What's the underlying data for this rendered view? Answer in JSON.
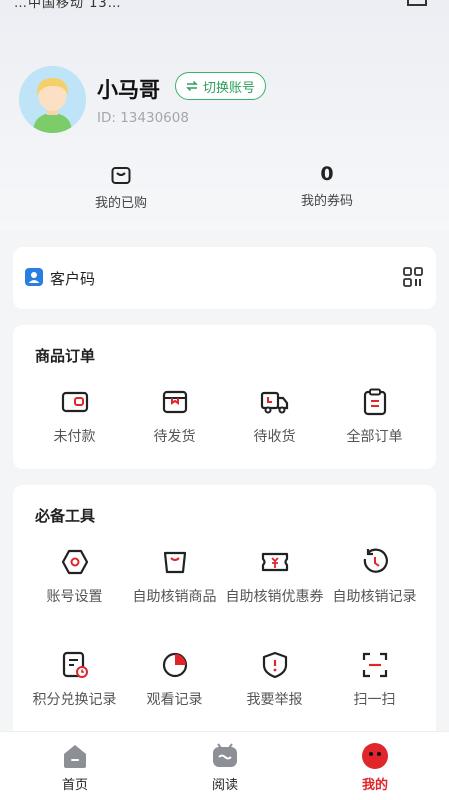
{
  "status_bar": {
    "text": "…中国移动 13…"
  },
  "profile": {
    "username": "小马哥",
    "switch_label": "切换账号",
    "user_id": "ID: 13430608"
  },
  "stats": [
    {
      "label": "我的已购",
      "value": ""
    },
    {
      "label": "我的券码",
      "value": "0"
    }
  ],
  "customer_code": {
    "label": "客户码"
  },
  "orders": {
    "title": "商品订单",
    "items": [
      {
        "label": "未付款",
        "icon": "wallet-icon"
      },
      {
        "label": "待发货",
        "icon": "box-icon"
      },
      {
        "label": "待收货",
        "icon": "truck-icon"
      },
      {
        "label": "全部订单",
        "icon": "clipboard-icon"
      }
    ]
  },
  "tools": {
    "title": "必备工具",
    "items": [
      {
        "label": "账号设置",
        "icon": "settings-icon"
      },
      {
        "label": "自助核销商品",
        "icon": "bag-icon"
      },
      {
        "label": "自助核销优惠券",
        "icon": "coupon-icon"
      },
      {
        "label": "自助核销记录",
        "icon": "history-icon"
      },
      {
        "label": "积分兑换记录",
        "icon": "points-record-icon"
      },
      {
        "label": "观看记录",
        "icon": "pie-icon"
      },
      {
        "label": "我要举报",
        "icon": "report-icon"
      },
      {
        "label": "扫一扫",
        "icon": "scan-icon"
      }
    ]
  },
  "tabbar": {
    "items": [
      {
        "label": "首页",
        "icon": "home-icon"
      },
      {
        "label": "阅读",
        "icon": "read-icon"
      },
      {
        "label": "我的",
        "icon": "mine-icon",
        "active": true
      }
    ]
  },
  "colors": {
    "accent_green": "#3bb26b",
    "accent_red": "#e0262b",
    "brand_blue": "#2a7de1"
  }
}
